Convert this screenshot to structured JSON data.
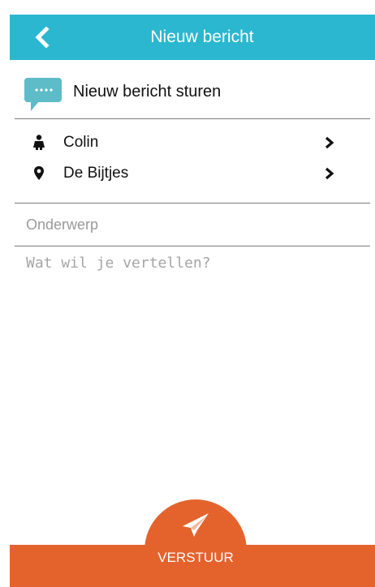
{
  "appbar": {
    "title": "Nieuw bericht",
    "back_icon": "chevron-left-icon",
    "color": "#2bb7d0"
  },
  "compose": {
    "header_title": "Nieuw bericht sturen",
    "header_icon": "chat-bubble-icon",
    "recipient": {
      "label": "Colin",
      "icon": "person-icon"
    },
    "location": {
      "label": "De Bijtjes",
      "icon": "location-pin-icon"
    },
    "subject_placeholder": "Onderwerp",
    "message_placeholder": "Wat wil je vertellen?"
  },
  "footer": {
    "send_label": "VERSTUUR",
    "send_icon": "paper-plane-icon",
    "color": "#e4632d"
  }
}
